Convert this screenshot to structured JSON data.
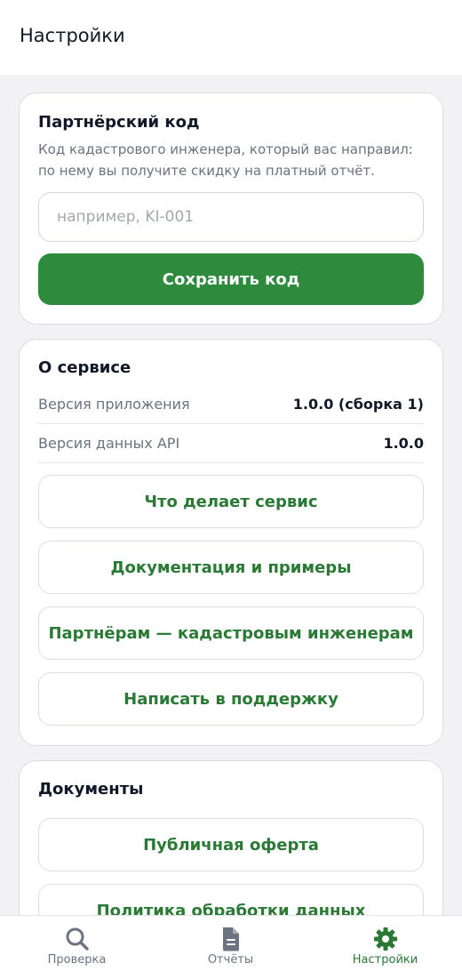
{
  "header": {
    "title": "Настройки"
  },
  "partner": {
    "title": "Партнёрский код",
    "description": "Код кадастрового инженера, который вас направил: по нему вы получите скидку на платный отчёт.",
    "input_placeholder": "например, KI-001",
    "input_value": "",
    "save_label": "Сохранить код"
  },
  "about": {
    "title": "О сервисе",
    "rows": [
      {
        "label": "Версия приложения",
        "value": "1.0.0 (сборка 1)"
      },
      {
        "label": "Версия данных API",
        "value": "1.0.0"
      }
    ],
    "buttons": [
      "Что делает сервис",
      "Документация и примеры",
      "Партнёрам — кадастровым инженерам",
      "Написать в поддержку"
    ]
  },
  "documents": {
    "title": "Документы",
    "buttons": [
      "Публичная оферта",
      "Политика обработки данных"
    ]
  },
  "tabbar": {
    "tabs": [
      {
        "label": "Проверка",
        "icon": "search-icon",
        "active": false
      },
      {
        "label": "Отчёты",
        "icon": "document-icon",
        "active": false
      },
      {
        "label": "Настройки",
        "icon": "gear-icon",
        "active": true
      }
    ]
  },
  "colors": {
    "accent": "#2e8b3e",
    "accent_text": "#2a7a35",
    "inactive_icon": "#6b7280",
    "background": "#f2f2f4"
  }
}
